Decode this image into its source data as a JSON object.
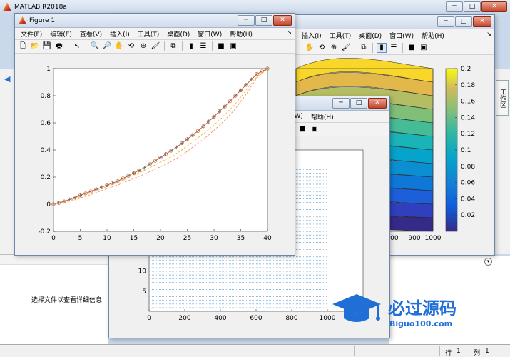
{
  "main": {
    "title": "MATLAB R2018a",
    "details_message": "选择文件以查看详细信息",
    "workspace_tab": "工作区",
    "status": {
      "row_label": "行",
      "row_value": "1",
      "col_label": "列",
      "col_value": "1"
    }
  },
  "icons": {
    "minimize": "─",
    "maximize": "□",
    "close": "✕",
    "back": "◀",
    "chevron_down": "▾",
    "menu_arrow": "↘",
    "new": "🗋",
    "open": "📂",
    "save": "💾",
    "print": "🖶",
    "pointer": "↖",
    "zoom_in": "🔍",
    "zoom_out": "🔎",
    "pan": "✋",
    "rotate": "⟲",
    "datatip": "⊕",
    "brush": "🖌",
    "link": "⧉",
    "colorbar": "▮",
    "legend": "☰",
    "hide": "■",
    "show": "▣"
  },
  "figure1": {
    "title": "Figure 1",
    "menu": [
      "文件(F)",
      "编辑(E)",
      "查看(V)",
      "插入(I)",
      "工具(T)",
      "桌面(D)",
      "窗口(W)",
      "帮助(H)"
    ]
  },
  "figure3": {
    "menu": [
      "插入(I)",
      "工具(T)",
      "桌面(D)",
      "窗口(W)",
      "帮助(H)"
    ]
  },
  "figure2": {
    "menu": [
      "(W)",
      "帮助(H)"
    ]
  },
  "chart_data": [
    {
      "type": "line",
      "x": [
        0,
        1,
        2,
        3,
        4,
        5,
        6,
        7,
        8,
        9,
        10,
        11,
        12,
        13,
        14,
        15,
        16,
        17,
        18,
        19,
        20,
        21,
        22,
        23,
        24,
        25,
        26,
        27,
        28,
        29,
        30,
        31,
        32,
        33,
        34,
        35,
        36,
        37,
        38,
        39,
        40
      ],
      "series": [
        {
          "values": [
            0,
            0.01,
            0.02,
            0.035,
            0.05,
            0.065,
            0.08,
            0.095,
            0.11,
            0.125,
            0.14,
            0.155,
            0.17,
            0.19,
            0.21,
            0.23,
            0.25,
            0.27,
            0.295,
            0.32,
            0.345,
            0.37,
            0.395,
            0.42,
            0.45,
            0.48,
            0.51,
            0.54,
            0.575,
            0.61,
            0.645,
            0.685,
            0.72,
            0.76,
            0.8,
            0.84,
            0.88,
            0.92,
            0.96,
            0.98,
            1.0
          ],
          "color": "#0072bd",
          "marker": "+"
        },
        {
          "values": [
            0,
            0.01,
            0.02,
            0.035,
            0.05,
            0.065,
            0.08,
            0.095,
            0.11,
            0.125,
            0.14,
            0.155,
            0.17,
            0.19,
            0.21,
            0.23,
            0.25,
            0.27,
            0.295,
            0.32,
            0.345,
            0.37,
            0.395,
            0.42,
            0.45,
            0.48,
            0.51,
            0.54,
            0.575,
            0.61,
            0.645,
            0.685,
            0.72,
            0.76,
            0.8,
            0.84,
            0.88,
            0.92,
            0.96,
            0.98,
            1.0
          ],
          "color": "#d95319",
          "marker": "o"
        },
        {
          "values": [
            0,
            0.008,
            0.016,
            0.028,
            0.04,
            0.055,
            0.07,
            0.085,
            0.1,
            0.115,
            0.13,
            0.145,
            0.16,
            0.178,
            0.196,
            0.214,
            0.232,
            0.25,
            0.27,
            0.29,
            0.31,
            0.33,
            0.35,
            0.375,
            0.4,
            0.43,
            0.46,
            0.49,
            0.52,
            0.55,
            0.585,
            0.62,
            0.66,
            0.7,
            0.74,
            0.79,
            0.84,
            0.89,
            0.94,
            0.97,
            1.0
          ],
          "color": "#edb120",
          "marker": "",
          "dash": true
        },
        {
          "values": [
            0,
            0.006,
            0.012,
            0.022,
            0.032,
            0.045,
            0.058,
            0.072,
            0.086,
            0.1,
            0.114,
            0.128,
            0.142,
            0.158,
            0.174,
            0.19,
            0.206,
            0.222,
            0.24,
            0.258,
            0.276,
            0.295,
            0.315,
            0.338,
            0.362,
            0.39,
            0.42,
            0.45,
            0.48,
            0.51,
            0.545,
            0.58,
            0.62,
            0.66,
            0.705,
            0.755,
            0.81,
            0.87,
            0.93,
            0.965,
            1.0
          ],
          "color": "#ff7f50",
          "marker": "",
          "dash": true
        }
      ],
      "xlim": [
        0,
        40
      ],
      "ylim": [
        -0.2,
        1
      ],
      "xticks": [
        0,
        5,
        10,
        15,
        20,
        25,
        30,
        35,
        40
      ],
      "yticks": [
        -0.2,
        0,
        0.2,
        0.4,
        0.6,
        0.8,
        1
      ]
    },
    {
      "type": "line",
      "xticks": [
        0,
        200,
        400,
        600,
        800,
        1000
      ],
      "yticks": [
        5,
        10,
        15
      ],
      "xlim": [
        0,
        1200
      ],
      "ylim": [
        0,
        40
      ],
      "line_color": "#6aa6d6",
      "line_count": 40,
      "line_x_end": 1000
    },
    {
      "type": "heatmap",
      "xticks": [
        800,
        900,
        1000
      ],
      "colorbar_ticks": [
        0.02,
        0.04,
        0.06,
        0.08,
        0.1,
        0.12,
        0.14,
        0.16,
        0.18,
        0.2
      ],
      "colorbar_range": [
        0,
        0.2
      ]
    }
  ],
  "watermark": {
    "text": "必过源码",
    "url": "Biguo100.com"
  }
}
